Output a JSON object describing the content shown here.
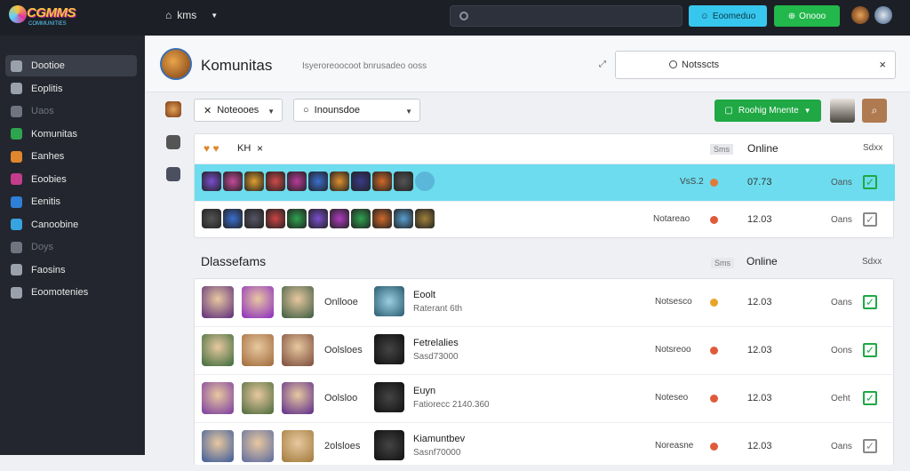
{
  "app": {
    "logo_text": "CGMMS",
    "logo_sub": "COMMUNITIES",
    "home_label": "kms"
  },
  "topbar": {
    "btn1": "Eoomeduo",
    "btn2": "Onooo"
  },
  "sidebar": {
    "items": [
      {
        "label": "Dootioe",
        "active": true,
        "dim": false,
        "icon": "search-icon",
        "color": "#9aa0ac"
      },
      {
        "label": "Eoplitis",
        "active": false,
        "dim": false,
        "icon": "user-icon",
        "color": "#9aa0ac"
      },
      {
        "label": "Uaos",
        "active": false,
        "dim": true,
        "icon": "box-icon",
        "color": "#6f7480"
      },
      {
        "label": "Komunitas",
        "active": false,
        "dim": false,
        "icon": "globe-icon",
        "color": "#2ea44f"
      },
      {
        "label": "Eanhes",
        "active": false,
        "dim": false,
        "icon": "fire-icon",
        "color": "#e0862e"
      },
      {
        "label": "Eoobies",
        "active": false,
        "dim": false,
        "icon": "heart-icon",
        "color": "#c43c8c"
      },
      {
        "label": "Eenitis",
        "active": false,
        "dim": false,
        "icon": "gem-icon",
        "color": "#2f7fd6"
      },
      {
        "label": "Canoobine",
        "active": false,
        "dim": false,
        "icon": "folder-icon",
        "color": "#37a4e0"
      },
      {
        "label": "Doys",
        "active": false,
        "dim": true,
        "icon": "circle-icon",
        "color": "#6f7480"
      },
      {
        "label": "Faosins",
        "active": false,
        "dim": false,
        "icon": "bag-icon",
        "color": "#9aa0ac"
      },
      {
        "label": "Eoomotenies",
        "active": false,
        "dim": false,
        "icon": "star-icon",
        "color": "#9aa0ac"
      }
    ]
  },
  "header": {
    "title": "Komunitas",
    "subtitle": "Isyeroreoocoot bnrusadeo ooss",
    "notif_label": "Notsscts"
  },
  "filters": {
    "dd1": "Noteooes",
    "dd2": "Inounsdoe",
    "green_btn": "Roohig Mnente"
  },
  "panel1": {
    "head": {
      "label": "KH",
      "col_badge": "Sms",
      "col_online": "Online",
      "col_last": "Sdxx"
    },
    "rows": [
      {
        "status": "VsS.2",
        "value": "07.73",
        "online": "Oans",
        "checked": true,
        "highlight": true,
        "dot": "#e07a3a"
      },
      {
        "status": "Notareao",
        "value": "12.03",
        "online": "Oans",
        "checked": false,
        "highlight": false,
        "dot": "#e05a3a"
      }
    ]
  },
  "section": {
    "title": "Dlassefams",
    "col_badge": "Sms",
    "col_online": "Online",
    "col_last": "Sdxx"
  },
  "cards": [
    {
      "label": "Onllooe",
      "name": "Eoolt",
      "sub": "Raterant 6th",
      "status": "Notsesco",
      "value": "12.03",
      "online": "Oans",
      "checked": true,
      "dot": "#e8a42a"
    },
    {
      "label": "Oolsloes",
      "name": "Fetrelalies",
      "sub": "Sasd73000",
      "status": "Notsreoo",
      "value": "12.03",
      "online": "Oons",
      "checked": true,
      "dot": "#e05a3a"
    },
    {
      "label": "Oolsloo",
      "name": "Euyn",
      "sub": "Fatiorecc 2140.360",
      "status": "Noteseo",
      "value": "12.03",
      "online": "Oeht",
      "checked": true,
      "dot": "#e05a3a"
    },
    {
      "label": "2olsloes",
      "name": "Kiamuntbev",
      "sub": "Sasnf70000",
      "status": "Noreasne",
      "value": "12.03",
      "online": "Oans",
      "checked": false,
      "dot": "#e05a3a"
    }
  ]
}
